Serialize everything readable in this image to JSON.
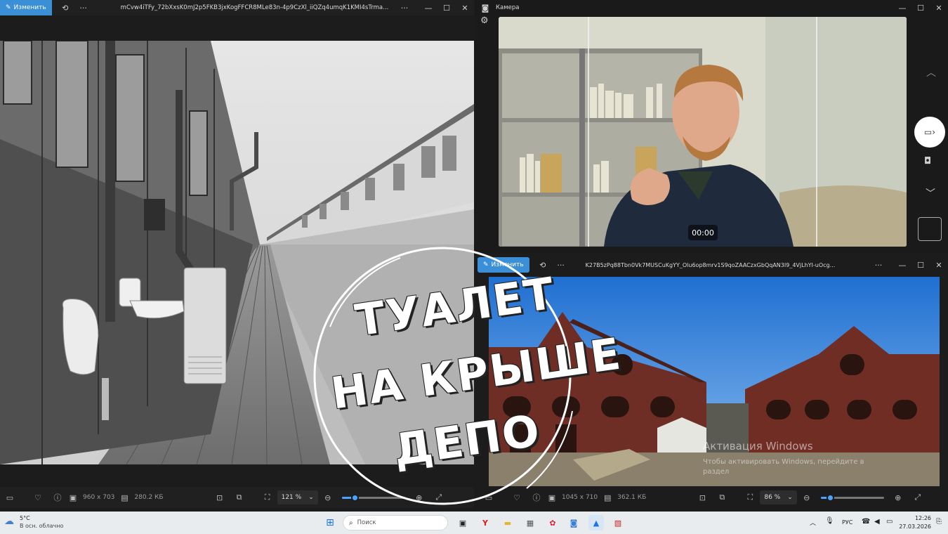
{
  "left_window": {
    "edit_label": "Изменить",
    "filename": "mCvw4iTFy_72bXxsK0mJ2p5FKB3jxKogFFCR8MLe83n-4p9CzXl_iiQZq4umqK1KMI4sTrma...",
    "dimensions": "960 x 703",
    "filesize": "280.2 КБ",
    "zoom": "121 %",
    "zoom_level": 0.2
  },
  "camera_window": {
    "title": "Камера",
    "timer": "00:00"
  },
  "right_window": {
    "edit_label": "Изменить",
    "filename": "K27B5zPq88Tbn0Vk7MUSCuKgYY_Olu6op8mrv1S9qoZAACzxGbQqAN3I9_4VjLhYI-uOcg...",
    "dimensions": "1045 x 710",
    "filesize": "362.1 КБ",
    "zoom": "86 %",
    "zoom_level": 0.15,
    "watermark_title": "Активация Windows",
    "watermark_sub1": "Чтобы активировать Windows, перейдите в",
    "watermark_sub2": "раздел"
  },
  "overlay": {
    "line1": "ТУАЛЕТ",
    "line2": "НА КРЫШЕ",
    "line3": "ДЕПО"
  },
  "taskbar": {
    "temperature": "5°C",
    "weather": "В осн. облачно",
    "search_placeholder": "Поиск",
    "language": "РУС",
    "time": "12:26",
    "date": "27.03.2026"
  },
  "colors": {
    "accent": "#3b8fd6",
    "slider": "#4aa3ff",
    "taskbar": "#e9ecef"
  }
}
